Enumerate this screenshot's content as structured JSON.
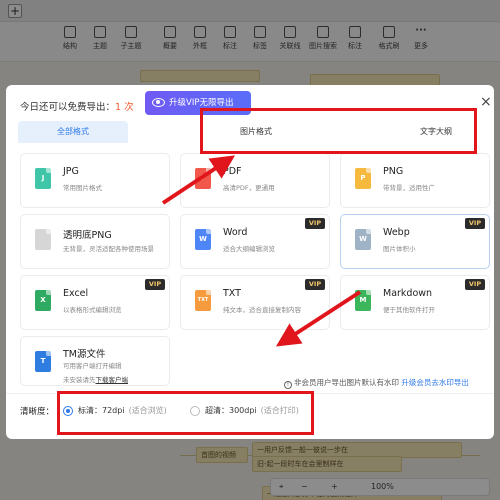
{
  "app": {
    "add_tab": "+",
    "toolbar": [
      {
        "id": "structure",
        "label": "结构"
      },
      {
        "id": "topic",
        "label": "主题"
      },
      {
        "id": "subtopic",
        "label": "子主题"
      },
      {
        "id": "summary",
        "label": "概要"
      },
      {
        "id": "frame",
        "label": "外框"
      },
      {
        "id": "label",
        "label": "标注"
      },
      {
        "id": "tag",
        "label": "标签"
      },
      {
        "id": "relation",
        "label": "关联线"
      },
      {
        "id": "image-search",
        "label": "图片搜索"
      },
      {
        "id": "note",
        "label": "标注"
      },
      {
        "id": "format",
        "label": "格式刷"
      },
      {
        "id": "more",
        "label": "更多"
      }
    ],
    "bg_nodes": [
      "首图的视频",
      "一用户反馈一般一彼说一步在",
      "旧-起一段时车在会里制样在",
      "一起通知部分不在对立刻在外"
    ],
    "zoom_label": "100%"
  },
  "modal": {
    "free_prefix": "今日还可以免费导出：",
    "free_count": "1 次",
    "vip_button": "升级VIP无限导出",
    "close": "×",
    "tabs": [
      {
        "label": "全部格式",
        "active": true
      },
      {
        "label": "图片格式",
        "active": false
      },
      {
        "label": "文字大纲",
        "active": false
      }
    ],
    "formats": [
      {
        "id": "jpg",
        "title": "JPG",
        "subtitle": "常用图片格式",
        "vip": false,
        "icon_color": "#3fc5a7",
        "icon_text": "J"
      },
      {
        "id": "pdf",
        "title": "PDF",
        "subtitle": "高清PDF，更通用",
        "vip": false,
        "icon_color": "#f1574a",
        "icon_text": "P"
      },
      {
        "id": "png",
        "title": "PNG",
        "subtitle": "带背景，适用性广",
        "vip": false,
        "icon_color": "#f5b93e",
        "icon_text": "P"
      },
      {
        "id": "transparent-png",
        "title": "透明底PNG",
        "subtitle": "无背景，灵活适配各种使用场景",
        "vip": false,
        "icon_color": "#d6d6d6",
        "icon_text": ""
      },
      {
        "id": "word",
        "title": "Word",
        "subtitle": "适合大纲编辑浏览",
        "vip": true,
        "icon_color": "#4f86f7",
        "icon_text": "W"
      },
      {
        "id": "webp",
        "title": "Webp",
        "subtitle": "图片体积小",
        "vip": true,
        "icon_color": "#9fb3c7",
        "icon_text": "W"
      },
      {
        "id": "excel",
        "title": "Excel",
        "subtitle": "以表格形式编辑浏览",
        "vip": true,
        "icon_color": "#2faa62",
        "icon_text": "X"
      },
      {
        "id": "txt",
        "title": "TXT",
        "subtitle": "纯文本，适合直接复制内容",
        "vip": true,
        "icon_color": "#f59b3d",
        "icon_text": "TXT"
      },
      {
        "id": "markdown",
        "title": "Markdown",
        "subtitle": "便于其他软件打开",
        "vip": true,
        "icon_color": "#3cb65a",
        "icon_text": "M"
      },
      {
        "id": "tm",
        "title": "TM源文件",
        "subtitle": "可用客户端打开编辑",
        "subtitle2": "未安装请先",
        "download_link": "下载客户端",
        "vip": false,
        "icon_color": "#2f7de1",
        "icon_text": "T"
      }
    ],
    "vip_tag": "VIP",
    "watermark_text": "非会员用户导出图片默认有水印",
    "watermark_link": "升级会员去水印导出",
    "watermark_icon": "info-icon",
    "resolution_label": "清晰度：",
    "resolutions": [
      {
        "label": "标清：72dpi",
        "hint": "(适合浏览)",
        "selected": true
      },
      {
        "label": "超清：300dpi",
        "hint": "(适合打印)",
        "selected": false
      }
    ]
  },
  "annotation_color": "#e0161c"
}
